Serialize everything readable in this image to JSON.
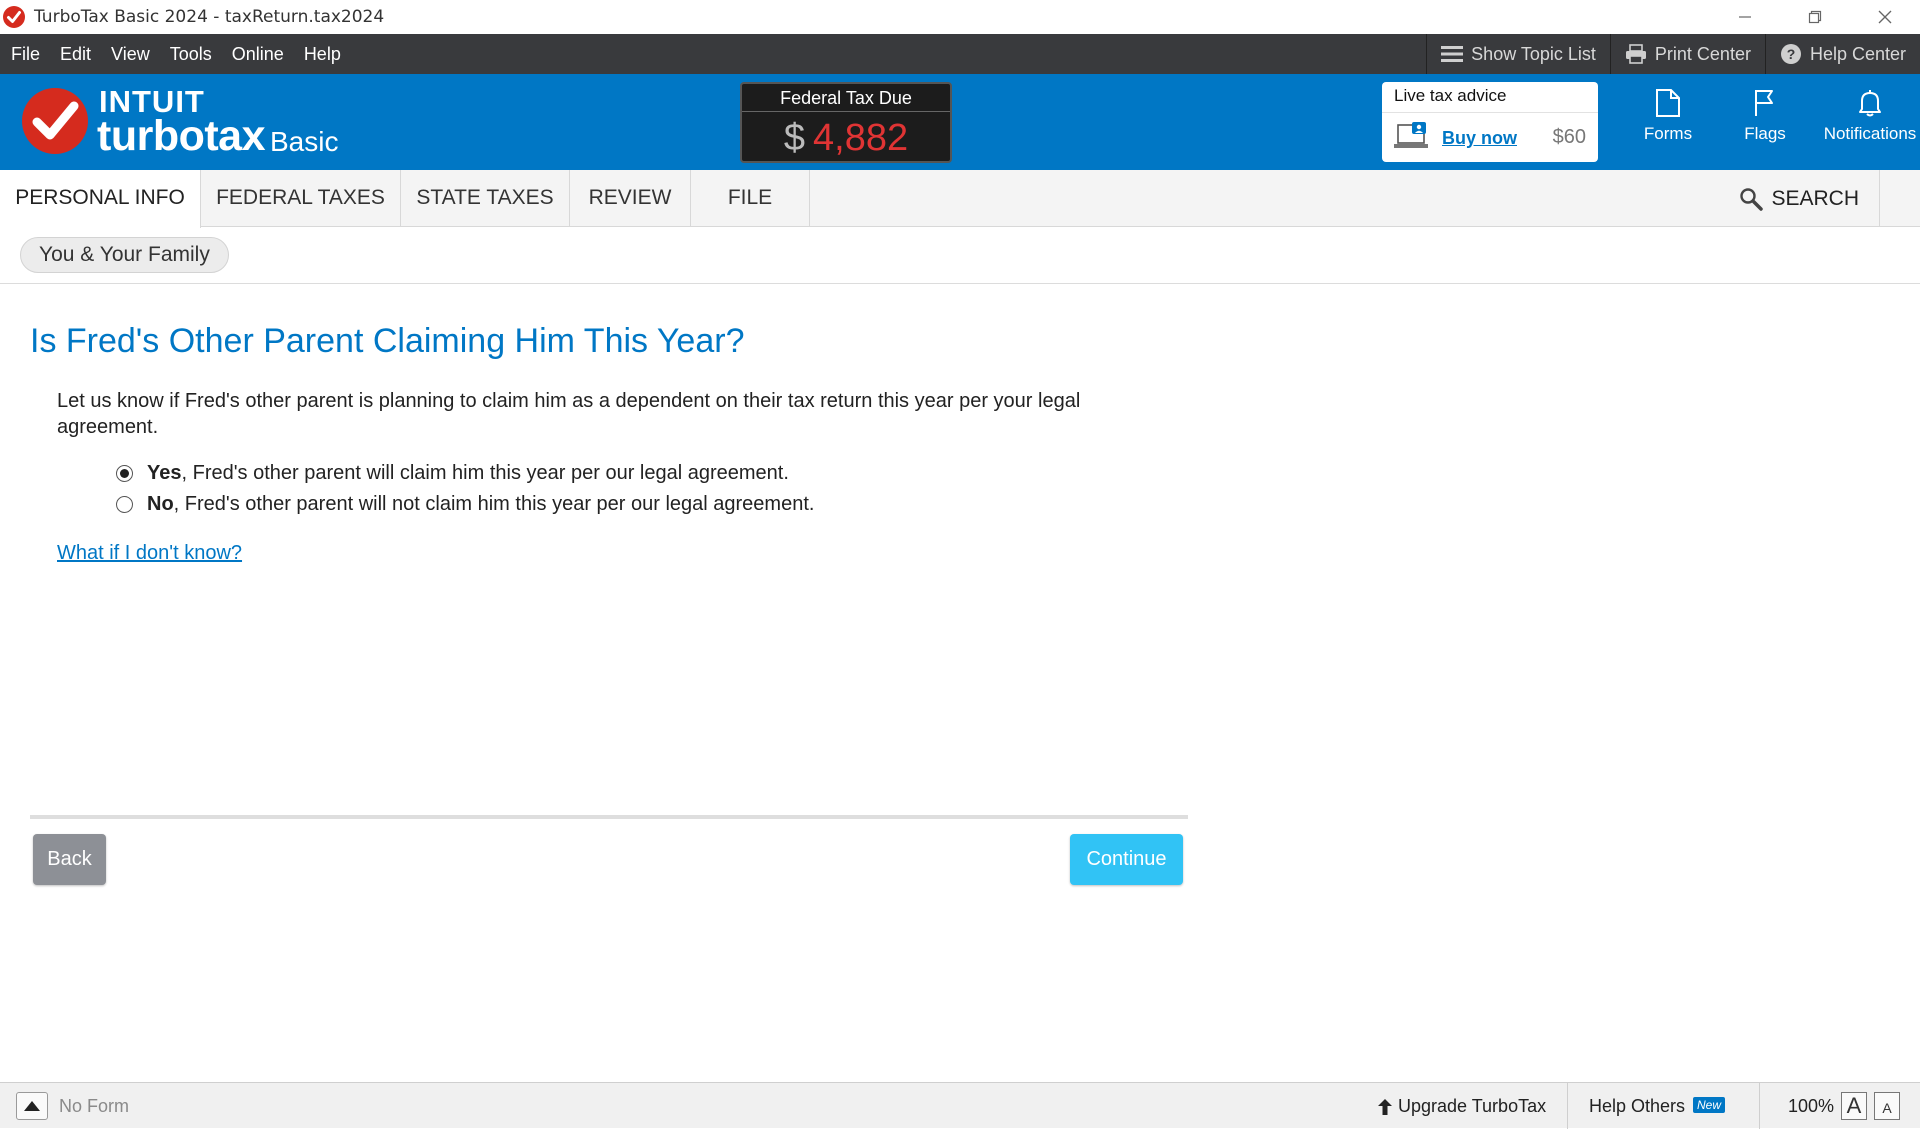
{
  "window": {
    "title": "TurboTax Basic 2024 - taxReturn.tax2024"
  },
  "menu": {
    "items": [
      "File",
      "Edit",
      "View",
      "Tools",
      "Online",
      "Help"
    ],
    "show_topic_list": "Show Topic List",
    "print_center": "Print Center",
    "help_center": "Help Center"
  },
  "header": {
    "brand_intuit": "INTUIT",
    "brand_turbotax": "turbotax",
    "brand_edition": "Basic",
    "tax_due_label": "Federal Tax Due",
    "tax_due_currency": "$",
    "tax_due_amount": "4,882",
    "live_advice_title": "Live tax advice",
    "live_advice_buy": "Buy now",
    "live_advice_price": "$60",
    "forms": "Forms",
    "flags": "Flags",
    "notifications": "Notifications"
  },
  "tabs": {
    "items": [
      "PERSONAL INFO",
      "FEDERAL TAXES",
      "STATE TAXES",
      "REVIEW",
      "FILE"
    ],
    "active": "PERSONAL INFO",
    "search": "SEARCH"
  },
  "breadcrumb": {
    "label": "You & Your Family"
  },
  "main": {
    "title": "Is Fred's Other Parent Claiming Him This Year?",
    "description": "Let us know if Fred's other parent is planning to claim him as a dependent on their tax return this year per your legal agreement.",
    "options": [
      {
        "bold": "Yes",
        "text": ", Fred's other parent will claim him this year per our legal agreement.",
        "selected": true
      },
      {
        "bold": "No",
        "text": ", Fred's other parent will not claim him this year per our legal agreement.",
        "selected": false
      }
    ],
    "help_link": "What if I don't know?",
    "back": "Back",
    "continue": "Continue"
  },
  "statusbar": {
    "no_form": "No Form",
    "upgrade": "Upgrade TurboTax",
    "help_others": "Help Others",
    "new_badge": "New",
    "zoom": "100%",
    "font_large": "A",
    "font_small": "A"
  },
  "colors": {
    "brand_blue": "#0077c5",
    "menubar": "#393a3d",
    "tax_due_red": "#e03434",
    "continue_button": "#31c3f5",
    "back_button": "#8d9096"
  }
}
